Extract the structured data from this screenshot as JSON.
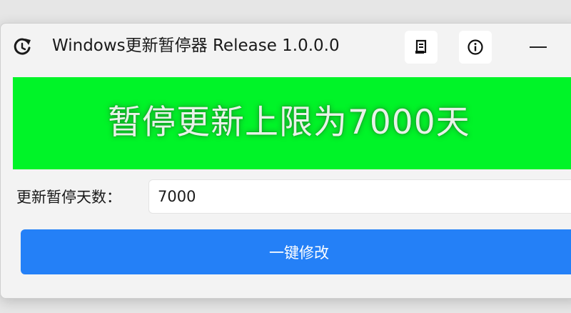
{
  "window": {
    "title": "Windows更新暂停器 Release 1.0.0.0",
    "app_icon": "refresh-clock-icon",
    "toolbar": {
      "doc_icon": "document-icon",
      "info_icon": "info-icon",
      "minimize_icon": "minimize-icon"
    }
  },
  "banner": {
    "text": "暂停更新上限为7000天",
    "background_color": "#00f428"
  },
  "form": {
    "days_label": "更新暂停天数：",
    "days_value": "7000",
    "submit_label": "一键修改"
  },
  "colors": {
    "accent": "#2480f7"
  }
}
